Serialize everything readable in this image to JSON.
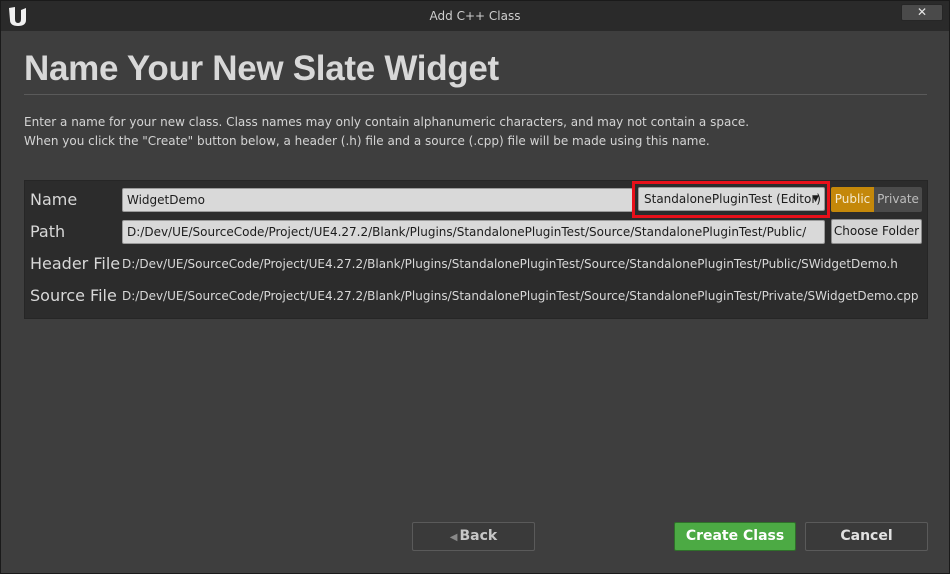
{
  "window": {
    "title": "Add C++ Class",
    "close_label": "✕"
  },
  "page": {
    "heading": "Name Your New Slate Widget",
    "description_line1": "Enter a name for your new class. Class names may only contain alphanumeric characters, and may not contain a space.",
    "description_line2": "When you click the \"Create\" button below, a header (.h) file and a source (.cpp) file will be made using this name."
  },
  "form": {
    "name_label": "Name",
    "name_value": "WidgetDemo",
    "module_value": "StandalonePluginTest (Editor)",
    "public_label": "Public",
    "private_label": "Private",
    "selected_visibility": "Public",
    "path_label": "Path",
    "path_value": "D:/Dev/UE/SourceCode/Project/UE4.27.2/Blank/Plugins/StandalonePluginTest/Source/StandalonePluginTest/Public/",
    "choose_folder_label": "Choose Folder",
    "header_file_label": "Header File",
    "header_file_value": "D:/Dev/UE/SourceCode/Project/UE4.27.2/Blank/Plugins/StandalonePluginTest/Source/StandalonePluginTest/Public/SWidgetDemo.h",
    "source_file_label": "Source File",
    "source_file_value": "D:/Dev/UE/SourceCode/Project/UE4.27.2/Blank/Plugins/StandalonePluginTest/Source/StandalonePluginTest/Private/SWidgetDemo.cpp"
  },
  "footer": {
    "back_label": "Back",
    "create_label": "Create Class",
    "cancel_label": "Cancel"
  },
  "colors": {
    "accent_public": "#c4880a",
    "create_button": "#4caa44",
    "highlight_box": "#e8101a"
  },
  "icons": {
    "logo": "unreal-engine-logo-icon",
    "close": "close-icon",
    "dropdown": "chevron-down-icon",
    "back": "chevron-left-icon"
  }
}
